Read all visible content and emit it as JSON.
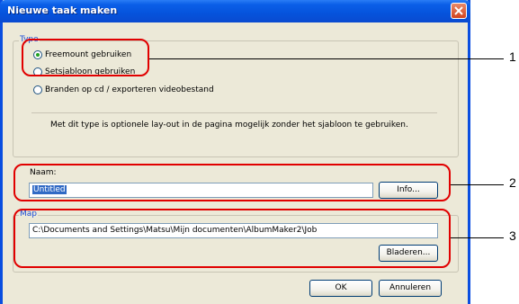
{
  "window": {
    "title": "Nieuwe taak maken"
  },
  "type_group": {
    "title": "Type",
    "options": [
      {
        "label": "Freemount gebruiken",
        "checked": true
      },
      {
        "label": "Setsjabloon gebruiken",
        "checked": false
      },
      {
        "label": "Branden op cd / exporteren videobestand",
        "checked": false
      }
    ],
    "description": "Met dit type is optionele lay-out in de pagina mogelijk zonder het sjabloon te gebruiken."
  },
  "name_field": {
    "label": "Naam:",
    "value": "Untitled",
    "info_button": "Info..."
  },
  "map_group": {
    "title": "Map",
    "path": "C:\\Documents and Settings\\Matsu\\Mijn documenten\\AlbumMaker2\\Job",
    "browse_button": "Bladeren..."
  },
  "footer": {
    "ok_button": "OK",
    "cancel_button": "Annuleren"
  },
  "callouts": [
    "1",
    "2",
    "3"
  ],
  "colors": {
    "highlight": "#e10000",
    "title_bar": "#0553dc",
    "dialog_bg": "#ece9d8",
    "group_title": "#1d4ed8"
  }
}
